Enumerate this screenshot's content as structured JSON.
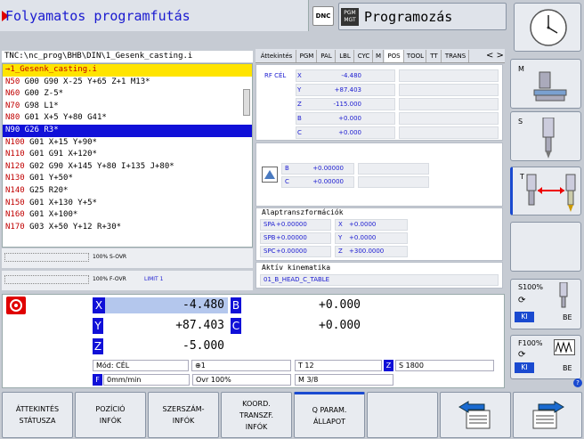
{
  "header": {
    "left_title": "Folyamatos programfutás",
    "dnc": "DNC",
    "pgm_badge": "PGM MGT",
    "right_title": "Programozás"
  },
  "program": {
    "path": "TNC:\\nc_prog\\BHB\\DIN\\1_Gesenk_casting.i",
    "lines": [
      {
        "n": "→1_Gesenk_casting.i",
        "rest": ""
      },
      {
        "n": "N50",
        "rest": " G00 G90 X-25 Y+65 Z+1 M13*"
      },
      {
        "n": "N60",
        "rest": " G00 Z-5*"
      },
      {
        "n": "N70",
        "rest": " G98 L1*"
      },
      {
        "n": "N80",
        "rest": " G01 X+5 Y+80 G41*"
      },
      {
        "n": "N90",
        "rest": " G26 R3*"
      },
      {
        "n": "N100",
        "rest": " G01 X+15 Y+90*"
      },
      {
        "n": "N110",
        "rest": " G01 G91 X+120*"
      },
      {
        "n": "N120",
        "rest": " G02 G90 X+145 Y+80 I+135 J+80*"
      },
      {
        "n": "N130",
        "rest": " G01 Y+50*"
      },
      {
        "n": "N140",
        "rest": " G25 R20*"
      },
      {
        "n": "N150",
        "rest": " G01 X+130 Y+5*"
      },
      {
        "n": "N160",
        "rest": " G01 X+100*"
      },
      {
        "n": "N170",
        "rest": " G03 X+50 Y+12 R+30*"
      }
    ],
    "selected_index": 5
  },
  "overrides": {
    "s": "100% S-OVR",
    "f": "100% F-OVR",
    "limit": "LIMIT 1"
  },
  "status_tabs": [
    "Áttekintés",
    "PGM",
    "PAL",
    "LBL",
    "CYC",
    "M",
    "POS",
    "TOOL",
    "TT",
    "TRANS"
  ],
  "active_tab": "POS",
  "pos_panel": {
    "label": "RF CÉL",
    "rows": [
      {
        "ax": "X",
        "val": "-4.480"
      },
      {
        "ax": "Y",
        "val": "+87.403"
      },
      {
        "ax": "Z",
        "val": "-115.000"
      },
      {
        "ax": "B",
        "val": "+0.000"
      },
      {
        "ax": "C",
        "val": "+0.000"
      }
    ]
  },
  "rot_panel": {
    "rows": [
      {
        "ax": "B",
        "val": "+0.00000"
      },
      {
        "ax": "C",
        "val": "+0.00000"
      }
    ]
  },
  "basic_transform": {
    "title": "Alaptranszformációk",
    "rows": [
      {
        "a": "SPA",
        "av": "+0.00000",
        "b": "X",
        "bv": "+0.0000"
      },
      {
        "a": "SPB",
        "av": "+0.00000",
        "b": "Y",
        "bv": "+0.0000"
      },
      {
        "a": "SPC",
        "av": "+0.00000",
        "b": "Z",
        "bv": "+300.0000"
      }
    ]
  },
  "kinematics": {
    "title": "Aktív kinematika",
    "value": "01_B_HEAD_C_TABLE"
  },
  "positions": {
    "X": "-4.480",
    "Y": "+87.403",
    "Z": "-5.000",
    "B": "+0.000",
    "C": "+0.000"
  },
  "status_bar": {
    "mode": "Mód: CÉL",
    "tool_num": "1",
    "t": "T 12",
    "s": "S 1800",
    "f": "0mm/min",
    "ovr": "Ovr 100%",
    "m": "M 3/8"
  },
  "softkeys": [
    "ÁTTEKINTÉS STÁTUSZA",
    "POZÍCIÓ INFÓK",
    "SZERSZÁM- INFÓK",
    "KOORD. TRANSZF. INFÓK",
    "Q PARAM. ÁLLAPOT",
    "",
    ""
  ],
  "sidekeys": {
    "m": "M",
    "s": "S",
    "t": "T",
    "s_ovr": "S100%",
    "f_ovr": "F100%",
    "ki": "KI",
    "be": "BE"
  }
}
